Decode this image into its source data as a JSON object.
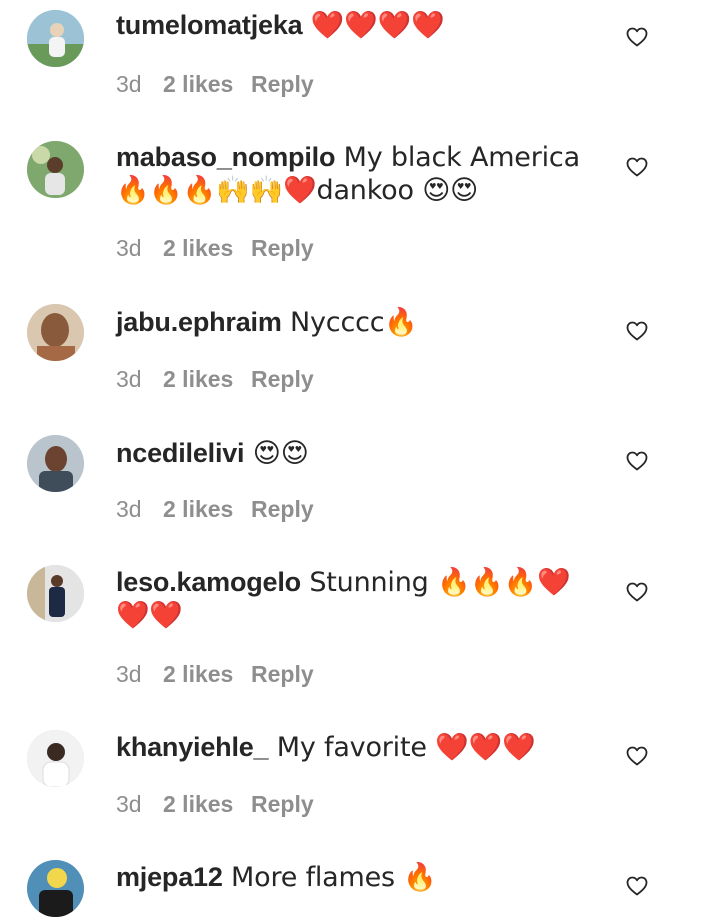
{
  "comments": [
    {
      "username": "tumelomatjeka",
      "text": " ❤️❤️❤️❤️",
      "time": "3d",
      "likes": "2 likes",
      "reply": "Reply"
    },
    {
      "username": "mabaso_nompilo",
      "text": " My black America 🔥🔥🔥🙌🙌❤️dankoo 😍😍",
      "time": "3d",
      "likes": "2 likes",
      "reply": "Reply"
    },
    {
      "username": "jabu.ephraim",
      "text": " Nycccc🔥",
      "time": "3d",
      "likes": "2 likes",
      "reply": "Reply"
    },
    {
      "username": "ncedilelivi",
      "text": " 😍😍",
      "time": "3d",
      "likes": "2 likes",
      "reply": "Reply"
    },
    {
      "username": "leso.kamogelo",
      "text": " Stunning 🔥🔥🔥❤️❤️❤️",
      "time": "3d",
      "likes": "2 likes",
      "reply": "Reply"
    },
    {
      "username": "khanyiehle_",
      "text": " My favorite ❤️❤️❤️",
      "time": "3d",
      "likes": "2 likes",
      "reply": "Reply"
    },
    {
      "username": "mjepa12",
      "text": " More flames 🔥",
      "time": "",
      "likes": "",
      "reply": ""
    }
  ],
  "colors": {
    "text": "#262626",
    "meta": "#8e8e8e",
    "background": "#ffffff"
  },
  "icons": {
    "like": "heart-outline-icon",
    "avatar": "user-avatar-photo"
  }
}
